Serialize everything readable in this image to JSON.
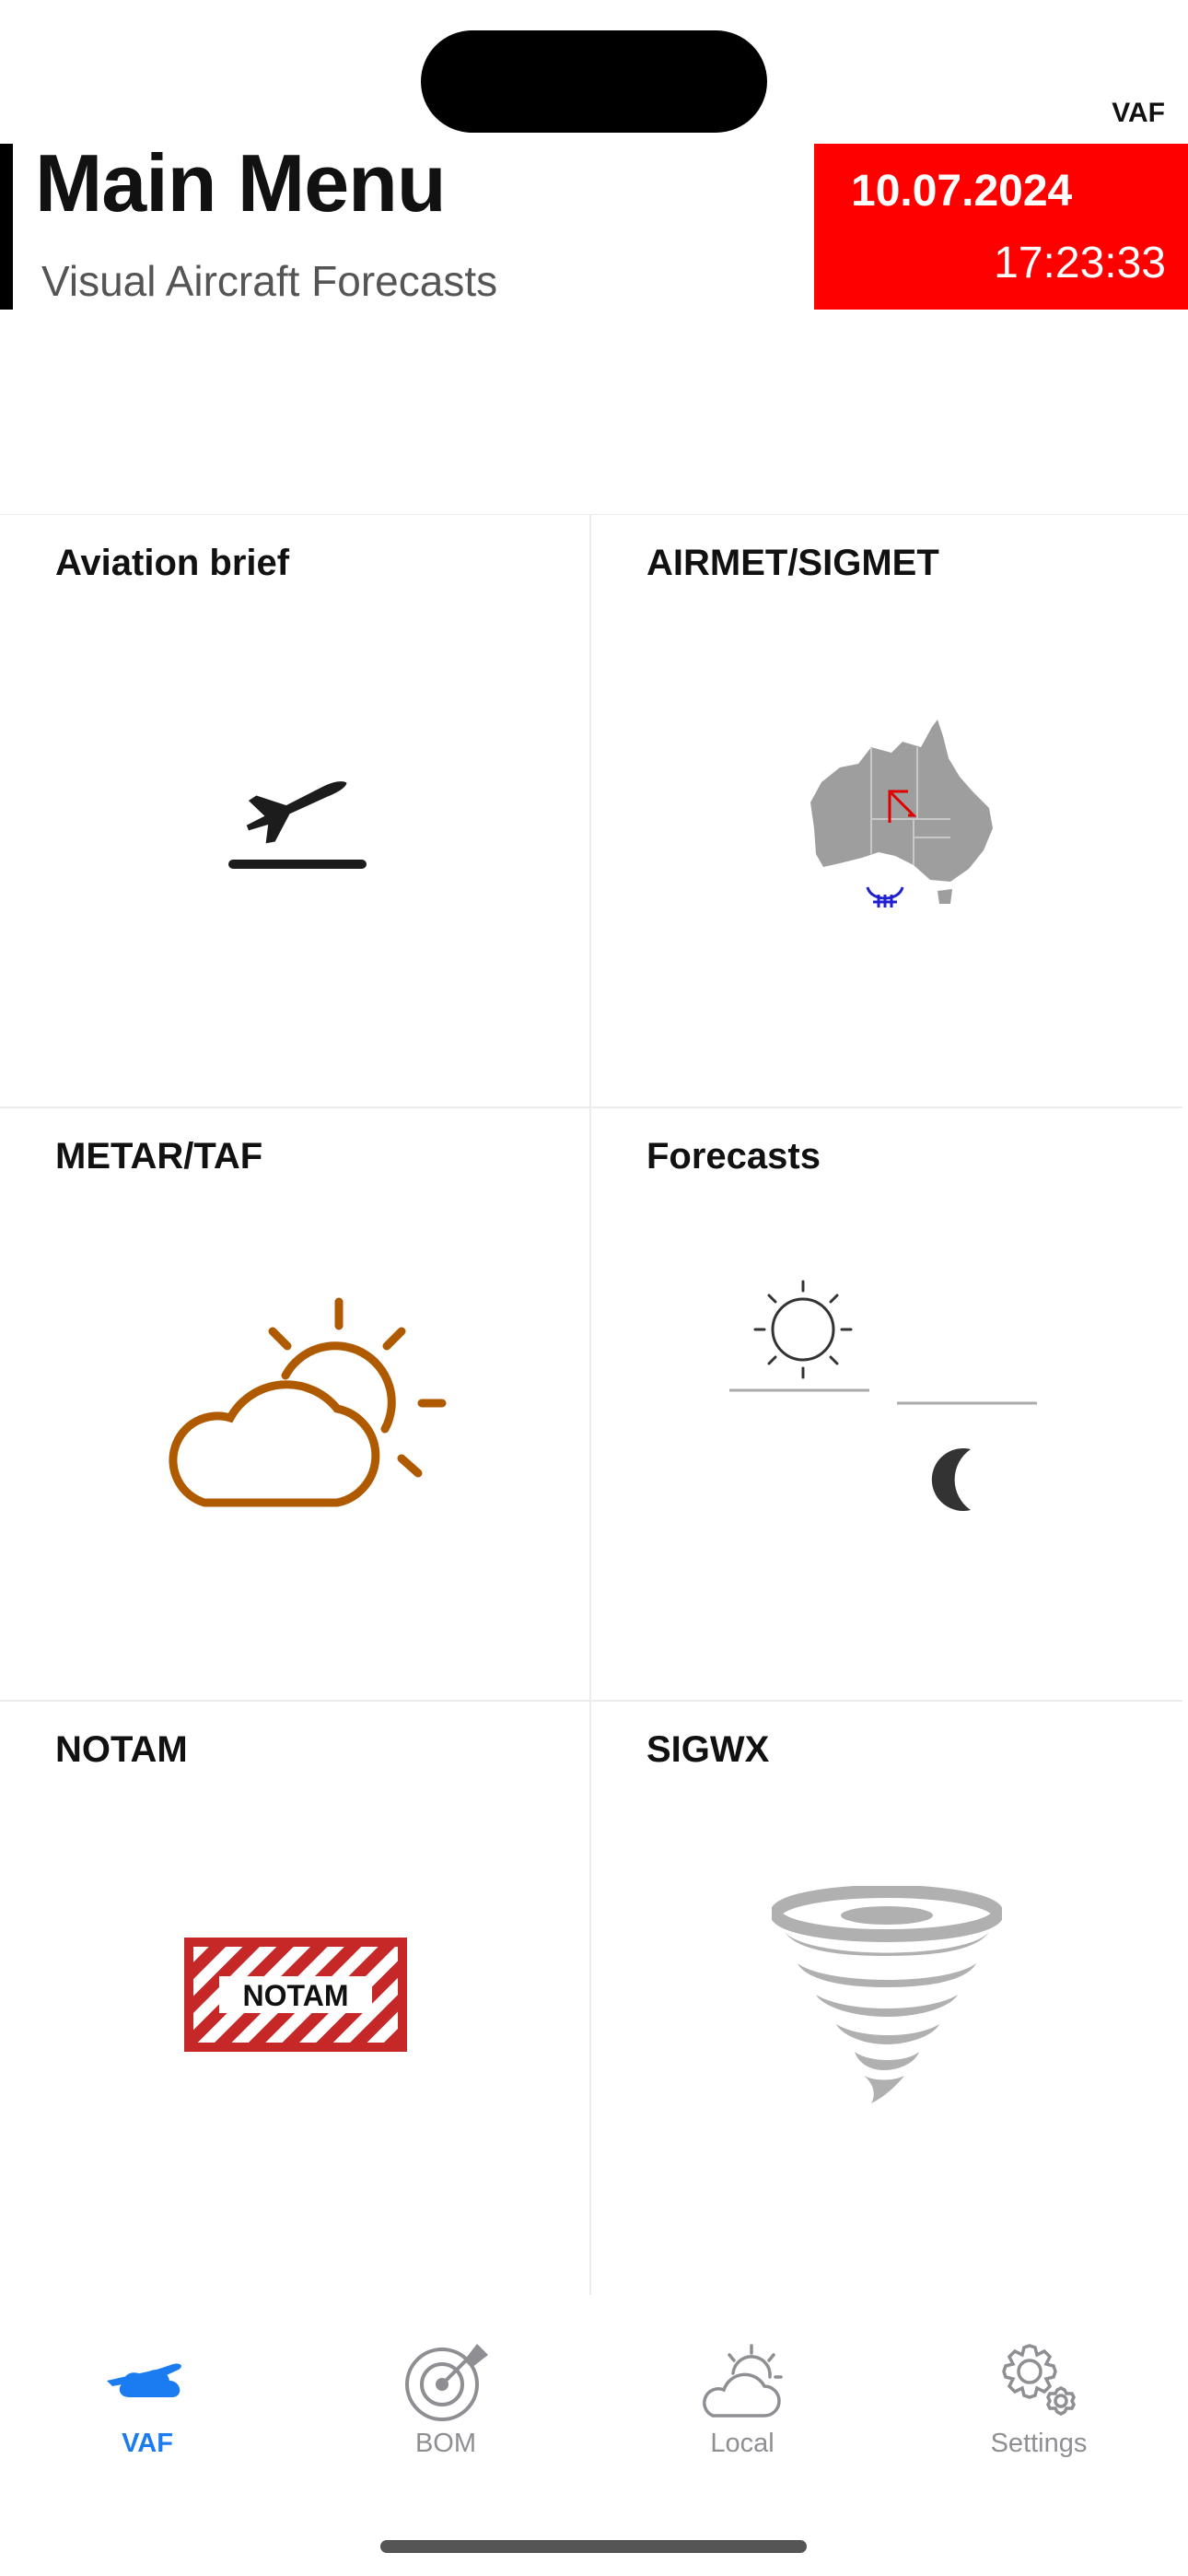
{
  "status_bar": {
    "brand_tag": "VAF"
  },
  "header": {
    "title": "Main Menu",
    "subtitle": "Visual Aircraft Forecasts",
    "date": "10.07.2024",
    "time": "17:23:33",
    "datetime_bg": "#ff0000"
  },
  "menu": {
    "tiles": [
      {
        "label": "Aviation brief",
        "icon": "airplane-takeoff-icon"
      },
      {
        "label": "AIRMET/SIGMET",
        "icon": "australia-map-icon"
      },
      {
        "label": "METAR/TAF",
        "icon": "partly-cloudy-icon"
      },
      {
        "label": "Forecasts",
        "icon": "sun-moon-icon"
      },
      {
        "label": "NOTAM",
        "icon": "notam-sign-icon",
        "sign_text": "NOTAM"
      },
      {
        "label": "SIGWX",
        "icon": "tornado-icon"
      }
    ]
  },
  "tabbar": {
    "active_color": "#1a7cf0",
    "items": [
      {
        "label": "VAF",
        "icon": "plane-cloud-icon",
        "active": true
      },
      {
        "label": "BOM",
        "icon": "radar-icon",
        "active": false
      },
      {
        "label": "Local",
        "icon": "cloud-sun-icon",
        "active": false
      },
      {
        "label": "Settings",
        "icon": "gear-icon",
        "active": false
      }
    ]
  }
}
